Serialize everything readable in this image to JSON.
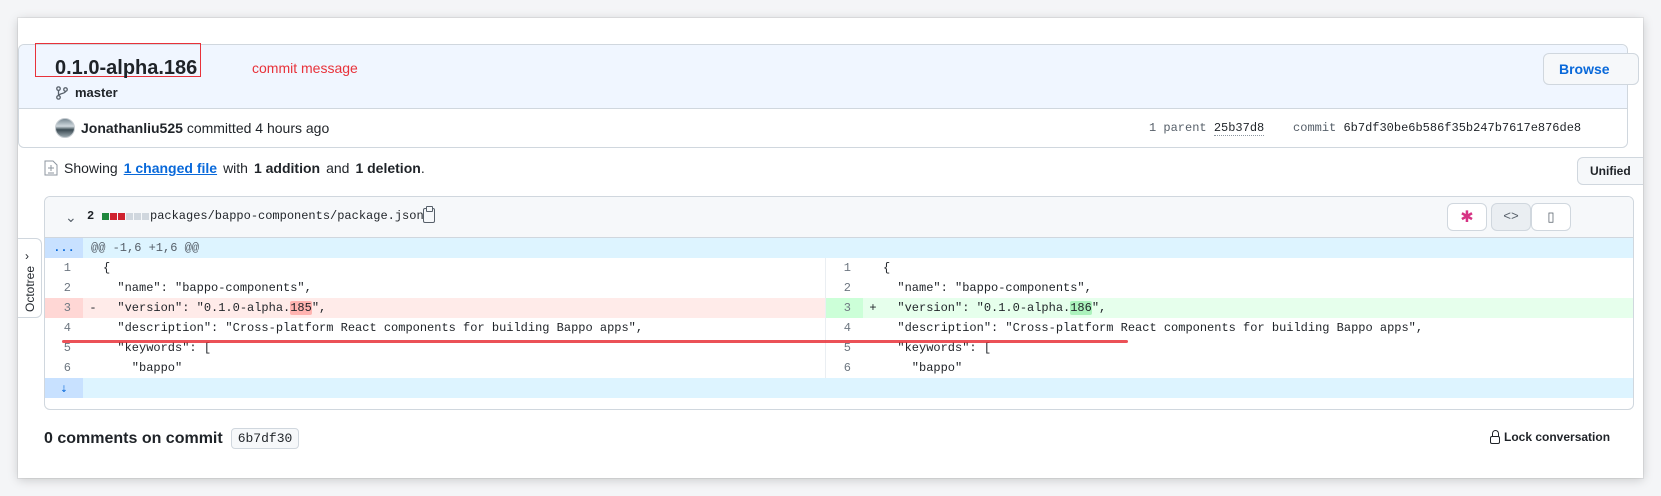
{
  "commit": {
    "title": "0.1.0-alpha.186",
    "annotation": "commit message",
    "branch": "master",
    "browse_label": "Browse",
    "author": "Jonathanliu525",
    "action": "committed",
    "time": "4 hours ago",
    "parents_label": "1 parent",
    "parent_sha": "25b37d8",
    "commit_label": "commit",
    "commit_sha": "6b7df30be6b586f35b247b7617e876de8"
  },
  "toc": {
    "showing": "Showing",
    "changed_files": "1 changed file",
    "with": "with",
    "additions": "1 addition",
    "and": "and",
    "deletions": "1 deletion",
    "period": ".",
    "view_mode": "Unified"
  },
  "file": {
    "change_count": "2",
    "path": "packages/bappo-components/package.json",
    "diffstat_colors": [
      "#1f883d",
      "#cf222e",
      "#cf222e",
      "#d0d7de",
      "#d0d7de",
      "#d0d7de"
    ],
    "hunk_expander": "...",
    "hunk_header": "@@ -1,6 +1,6 @@",
    "code_btn": "<>",
    "lines": [
      {
        "ln": "1",
        "lcode": "{",
        "rn": "1",
        "rcode": "{"
      },
      {
        "ln": "2",
        "lcode": "  \"name\": \"bappo-components\",",
        "rn": "2",
        "rcode": "  \"name\": \"bappo-components\","
      },
      {
        "ln": "3",
        "lsign": "-",
        "lcode_pre": "  \"version\": \"0.1.0-alpha.",
        "lcode_hl": "185",
        "lcode_post": "\",",
        "rn": "3",
        "rsign": "+",
        "rcode_pre": "  \"version\": \"0.1.0-alpha.",
        "rcode_hl": "186",
        "rcode_post": "\","
      },
      {
        "ln": "4",
        "lcode": "  \"description\": \"Cross-platform React components for building Bappo apps\",",
        "rn": "4",
        "rcode": "  \"description\": \"Cross-platform React components for building Bappo apps\","
      },
      {
        "ln": "5",
        "lcode": "  \"keywords\": [",
        "rn": "5",
        "rcode": "  \"keywords\": ["
      },
      {
        "ln": "6",
        "lcode": "    \"bappo\"",
        "rn": "6",
        "rcode": "    \"bappo\""
      }
    ]
  },
  "sidebar": {
    "octotree_label": "Octotree"
  },
  "comments": {
    "heading": "0 comments on commit",
    "sha": "6b7df30",
    "lock_label": "Lock conversation"
  }
}
